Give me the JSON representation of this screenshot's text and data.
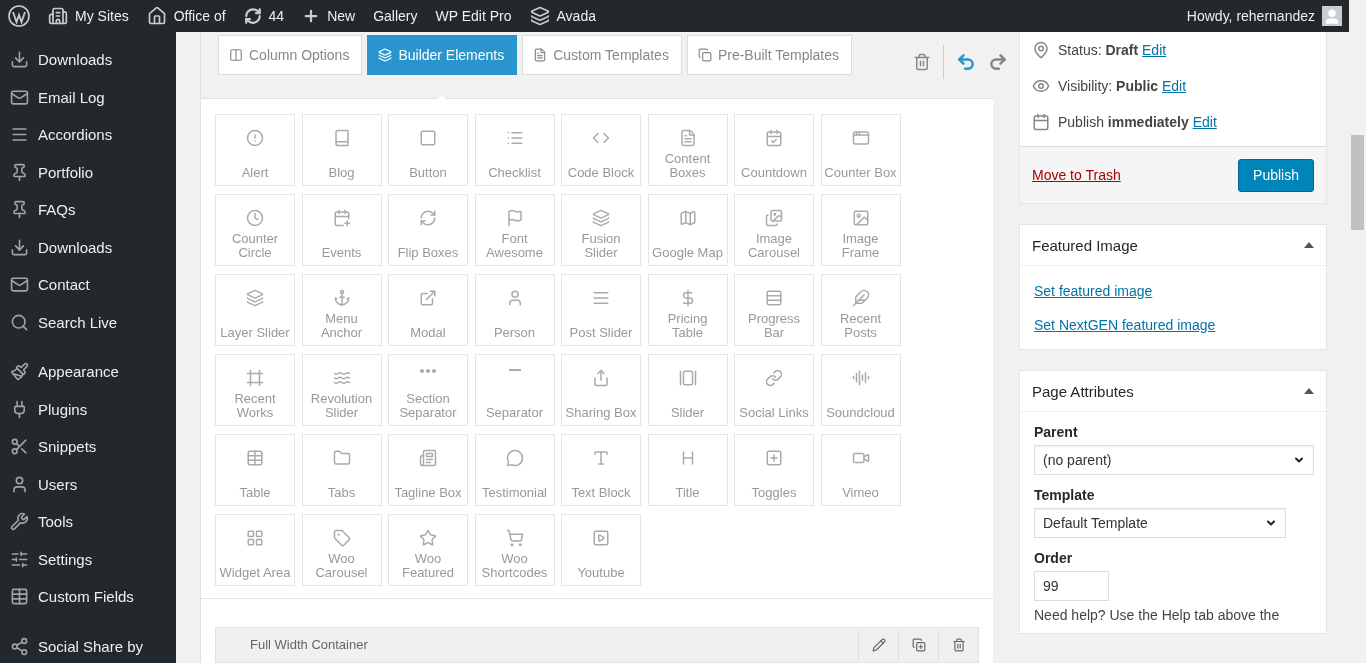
{
  "admin_bar": {
    "items": [
      {
        "kind": "logo"
      },
      {
        "kind": "sites",
        "label": "My Sites"
      },
      {
        "kind": "home",
        "label": "Office of"
      },
      {
        "kind": "updates",
        "label": "44"
      },
      {
        "kind": "new",
        "label": "New"
      },
      {
        "kind": "text",
        "label": "Gallery"
      },
      {
        "kind": "text",
        "label": "WP Edit Pro"
      },
      {
        "kind": "avada",
        "label": "Avada"
      }
    ],
    "greeting": "Howdy, rehernandez"
  },
  "sidebar": {
    "groups": [
      [
        {
          "label": "Downloads"
        },
        {
          "label": "Email Log"
        },
        {
          "label": "Accordions"
        },
        {
          "label": "Portfolio"
        },
        {
          "label": "FAQs"
        },
        {
          "label": "Downloads"
        },
        {
          "label": "Contact"
        },
        {
          "label": "Search Live"
        }
      ],
      [
        {
          "label": "Appearance"
        },
        {
          "label": "Plugins"
        },
        {
          "label": "Snippets"
        },
        {
          "label": "Users"
        },
        {
          "label": "Tools"
        },
        {
          "label": "Settings"
        },
        {
          "label": "Custom Fields"
        }
      ],
      [
        {
          "label": "Social Share by"
        }
      ]
    ]
  },
  "builder": {
    "tabs": [
      {
        "label": "Column Options",
        "selected": false
      },
      {
        "label": "Builder Elements",
        "selected": true
      },
      {
        "label": "Custom Templates",
        "selected": false
      },
      {
        "label": "Pre-Built Templates",
        "selected": false
      }
    ],
    "elements": [
      "Alert",
      "Blog",
      "Button",
      "Checklist",
      "Code Block",
      "Content Boxes",
      "Countdown",
      "Counter Box",
      "Counter Circle",
      "Events",
      "Flip Boxes",
      "Font Awesome",
      "Fusion Slider",
      "Google Map",
      "Image Carousel",
      "Image Frame",
      "Layer Slider",
      "Menu Anchor",
      "Modal",
      "Person",
      "Post Slider",
      "Pricing Table",
      "Progress Bar",
      "Recent Posts",
      "Recent Works",
      "Revolution Slider",
      "Section Separator",
      "Separator",
      "Sharing Box",
      "Slider",
      "Social Links",
      "Soundcloud",
      "Table",
      "Tabs",
      "Tagline Box",
      "Testimonial",
      "Text Block",
      "Title",
      "Toggles",
      "Vimeo",
      "Widget Area",
      "Woo Carousel",
      "Woo Featured",
      "Woo Shortcodes",
      "Youtube"
    ],
    "container": {
      "title": "Full Width Container"
    }
  },
  "publish_box": {
    "rows": [
      {
        "text": "Status: **Draft**",
        "link": "Edit"
      },
      {
        "text": "Visibility: **Public**",
        "link": "Edit"
      },
      {
        "text": "Publish **immediately**",
        "link": "Edit"
      }
    ],
    "trash": "Move to Trash",
    "button": "Publish"
  },
  "featured_image": {
    "title": "Featured Image",
    "expanded": true,
    "links": [
      "Set featured image",
      "Set NextGEN featured image"
    ]
  },
  "page_attributes": {
    "title": "Page Attributes",
    "expanded": true,
    "parent_label": "Parent",
    "parent": "(no parent)",
    "template_label": "Template",
    "template": "Default Template",
    "order_label": "Order",
    "order": "99",
    "help": "Need help? Use the Help tab above the"
  }
}
